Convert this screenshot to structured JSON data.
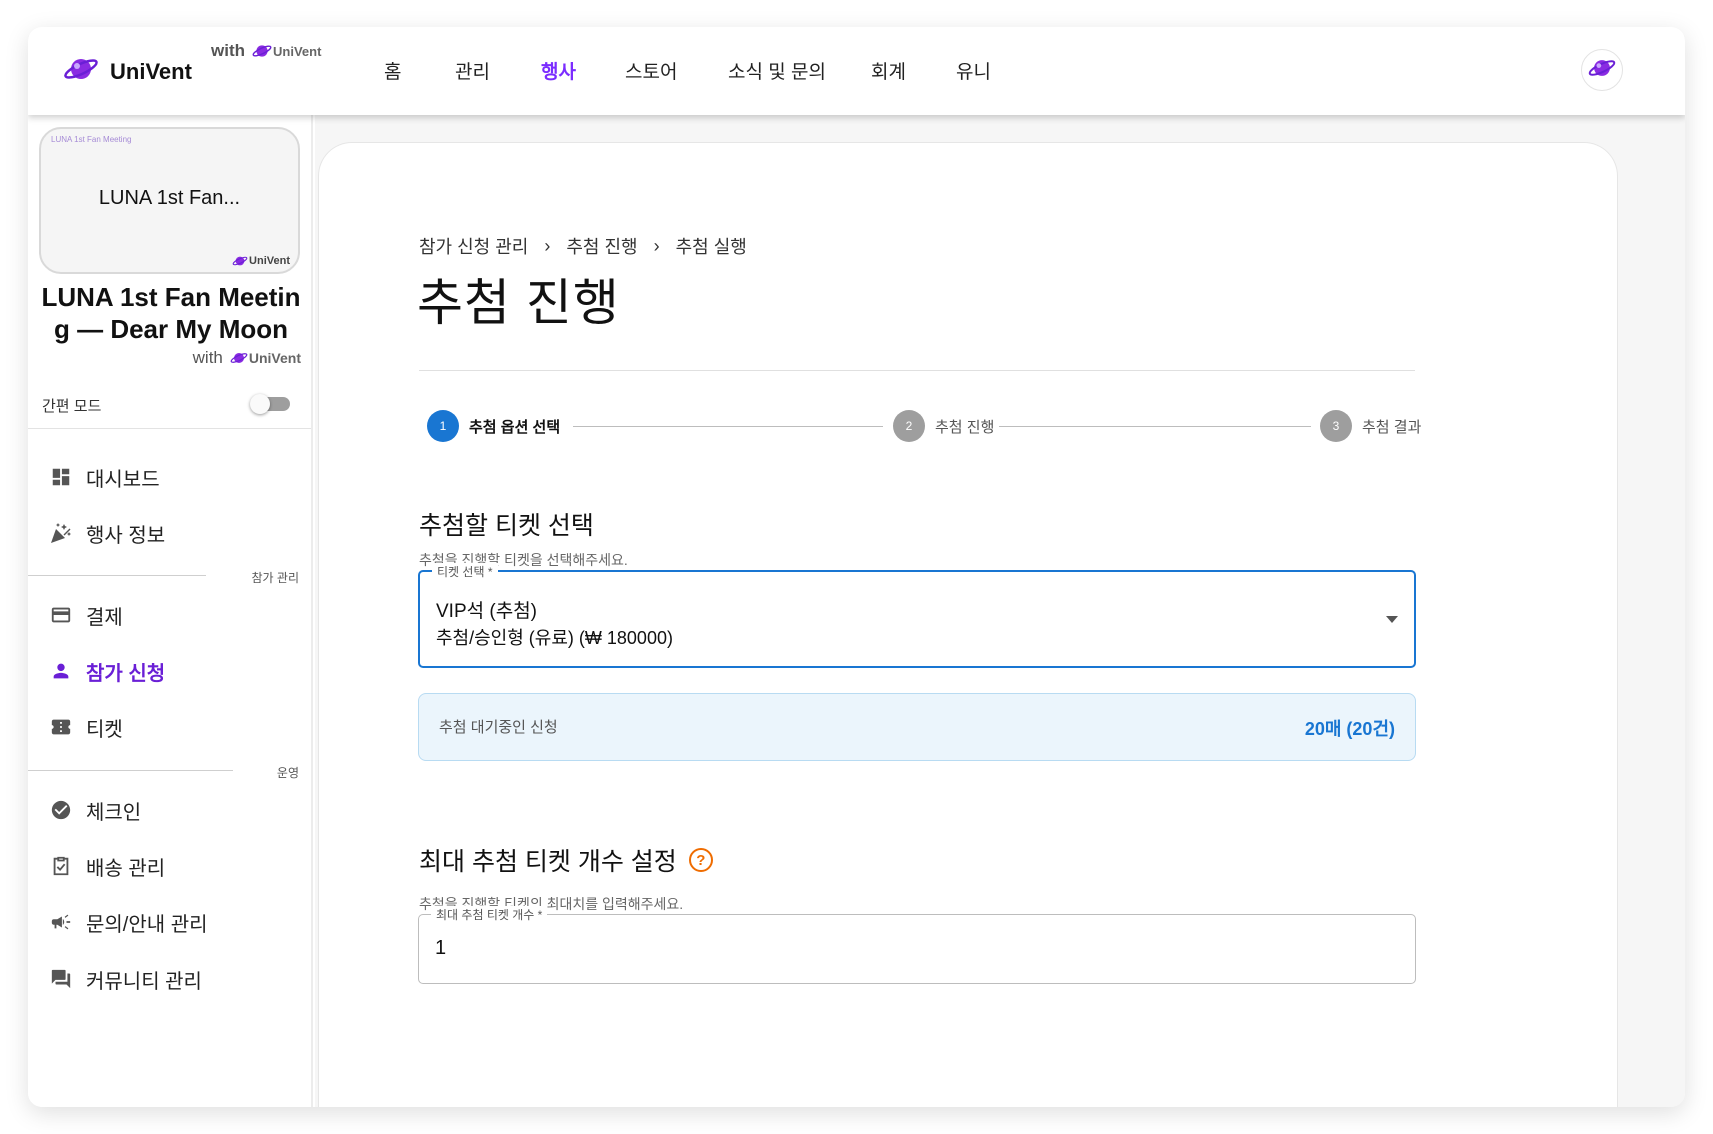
{
  "brand": {
    "name": "UniVent",
    "with_label": "with",
    "small_logo_text": "UniVent",
    "accent": "#7b2cff"
  },
  "nav": {
    "items": [
      "홈",
      "관리",
      "행사",
      "스토어",
      "소식 및 문의",
      "회계",
      "유니"
    ],
    "active": "행사"
  },
  "sidebar": {
    "thumbnail": {
      "tiny_text": "LUNA 1st Fan Meeting",
      "title": "LUNA 1st Fan...",
      "logo_text": "UniVent"
    },
    "event_title": "LUNA 1st Fan Meeting — Dear My Moon",
    "with_label": "with",
    "with_logo_text": "UniVent",
    "simple_mode_label": "간편 모드",
    "simple_mode_on": false,
    "items_top": [
      {
        "label": "대시보드",
        "icon": "dashboard-icon"
      },
      {
        "label": "행사 정보",
        "icon": "celebration-icon"
      }
    ],
    "section1_label": "참가 관리",
    "items_mid": [
      {
        "label": "결제",
        "icon": "credit-card-icon"
      },
      {
        "label": "참가 신청",
        "icon": "person-icon",
        "active": true
      },
      {
        "label": "티켓",
        "icon": "ticket-icon"
      }
    ],
    "section2_label": "운영",
    "items_bottom": [
      {
        "label": "체크인",
        "icon": "check-circle-icon"
      },
      {
        "label": "배송 관리",
        "icon": "clipboard-check-icon"
      },
      {
        "label": "문의/안내 관리",
        "icon": "megaphone-icon"
      },
      {
        "label": "커뮤니티 관리",
        "icon": "forum-icon"
      }
    ]
  },
  "breadcrumb": [
    "참가 신청 관리",
    "추첨 진행",
    "추첨 실행"
  ],
  "page_title": "추첨 진행",
  "stepper": [
    {
      "num": "1",
      "label": "추첨 옵션 선택",
      "active": true
    },
    {
      "num": "2",
      "label": "추첨 진행",
      "active": false
    },
    {
      "num": "3",
      "label": "추첨 결과",
      "active": false
    }
  ],
  "ticket_section": {
    "title": "추첨할 티켓 선택",
    "subtitle": "추첨을 진행할 티켓을 선택해주세요.",
    "select_label": "티켓 선택 *",
    "selected_name": "VIP석 (추첨)",
    "selected_detail": "추첨/승인형 (유료) (₩ 180000)"
  },
  "waiting": {
    "label": "추첨 대기중인 신청",
    "value": "20매 (20건)"
  },
  "max_section": {
    "title": "최대 추첨 티켓 개수 설정",
    "subtitle": "추첨을 진행할 티켓의 최대치를 입력해주세요.",
    "input_label": "최대 추첨 티켓 개수 *",
    "input_value": "1"
  }
}
